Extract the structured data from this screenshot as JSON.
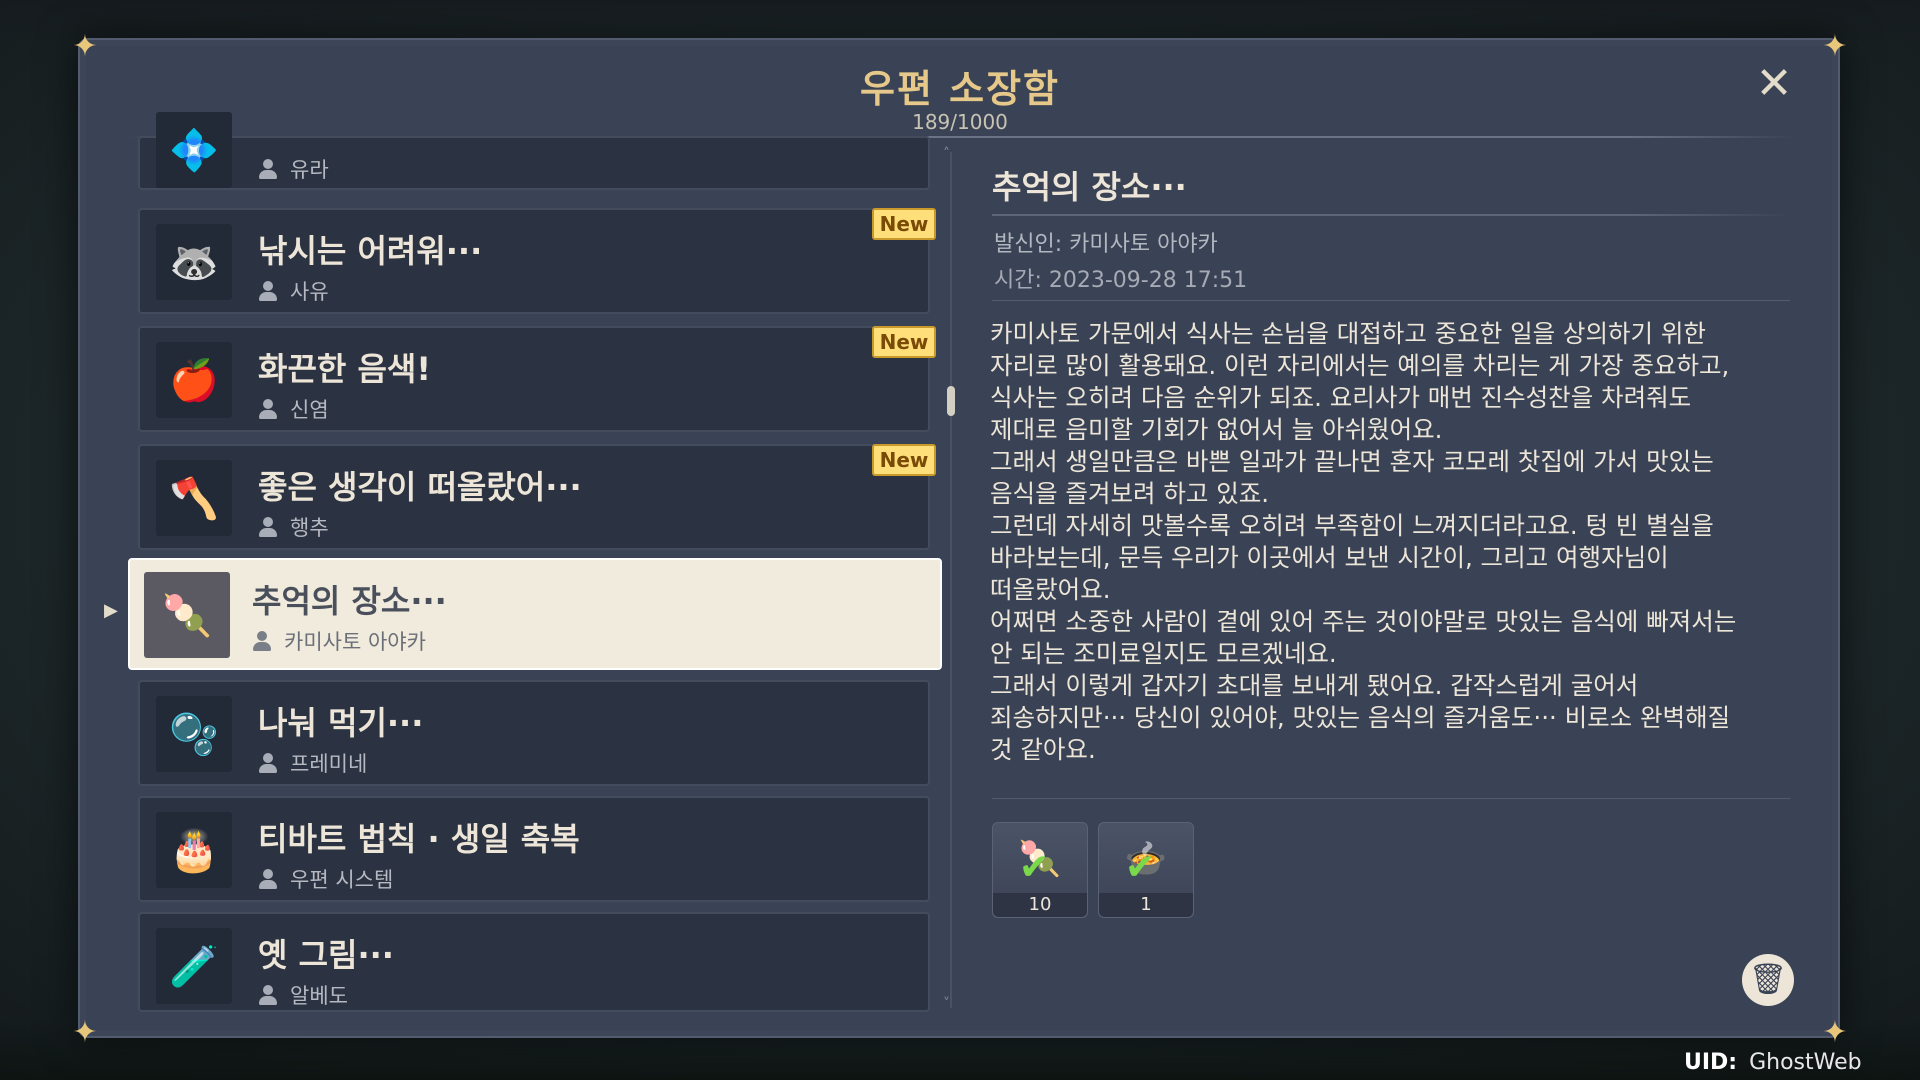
{
  "header": {
    "title": "우편 소장함",
    "count": "189/1000",
    "close_icon": "close-icon"
  },
  "mail_list": [
    {
      "subject": "",
      "sender": "유라",
      "new": false,
      "icon": "💠"
    },
    {
      "subject": "낚시는 어려워···",
      "sender": "사유",
      "new": true,
      "icon": "🦝"
    },
    {
      "subject": "화끈한 음색!",
      "sender": "신염",
      "new": true,
      "icon": "🍎"
    },
    {
      "subject": "좋은 생각이 떠올랐어···",
      "sender": "행추",
      "new": true,
      "icon": "🪓"
    },
    {
      "subject": "추억의 장소···",
      "sender": "카미사토 아야카",
      "new": false,
      "selected": true,
      "icon": "🍡"
    },
    {
      "subject": "나눠 먹기···",
      "sender": "프레미네",
      "new": false,
      "icon": "🫧"
    },
    {
      "subject": "티바트 법칙 · 생일 축복",
      "sender": "우편 시스템",
      "new": false,
      "icon": "🎂"
    },
    {
      "subject": "옛 그림···",
      "sender": "알베도",
      "new": false,
      "icon": "🧪"
    }
  ],
  "new_badge_label": "New",
  "detail": {
    "title": "추억의 장소···",
    "sender": "발신인: 카미사토 아야카",
    "time": "시간: 2023-09-28 17:51",
    "body": "카미사토 가문에서 식사는 손님을 대접하고 중요한 일을 상의하기 위한\n자리로 많이 활용돼요. 이런 자리에서는 예의를 차리는 게 가장 중요하고,\n식사는 오히려 다음 순위가 되죠. 요리사가 매번 진수성찬을 차려줘도\n제대로 음미할 기회가 없어서 늘 아쉬웠어요.\n그래서 생일만큼은 바쁜 일과가 끝나면 혼자 코모레 찻집에 가서 맛있는\n음식을 즐겨보려 하고 있죠.\n그런데 자세히 맛볼수록 오히려 부족함이 느껴지더라고요. 텅 빈 별실을\n바라보는데, 문득 우리가 이곳에서 보낸 시간이, 그리고 여행자님이\n떠올랐어요.\n어쩌면 소중한 사람이 곁에 있어 주는 것이야말로 맛있는 음식에 빠져서는\n안 되는 조미료일지도 모르겠네요.\n그래서 이렇게 갑자기 초대를 보내게 됐어요. 갑작스럽게 굴어서\n죄송하지만··· 당신이 있어야, 맛있는 음식의 즐거움도··· 비로소 완벽해질\n것 같아요.",
    "attachments": [
      {
        "count": "10",
        "icon": "🍡",
        "claimed": true
      },
      {
        "count": "1",
        "icon": "🍲",
        "claimed": true
      }
    ]
  },
  "footer": {
    "uid_label": "UID:",
    "uid_value": "GhostWeb"
  },
  "colors": {
    "panel": "#3a4355",
    "gold": "#e6c98a",
    "new_badge": "#ffdf7a",
    "selected_bg": "#f1ebdd"
  }
}
